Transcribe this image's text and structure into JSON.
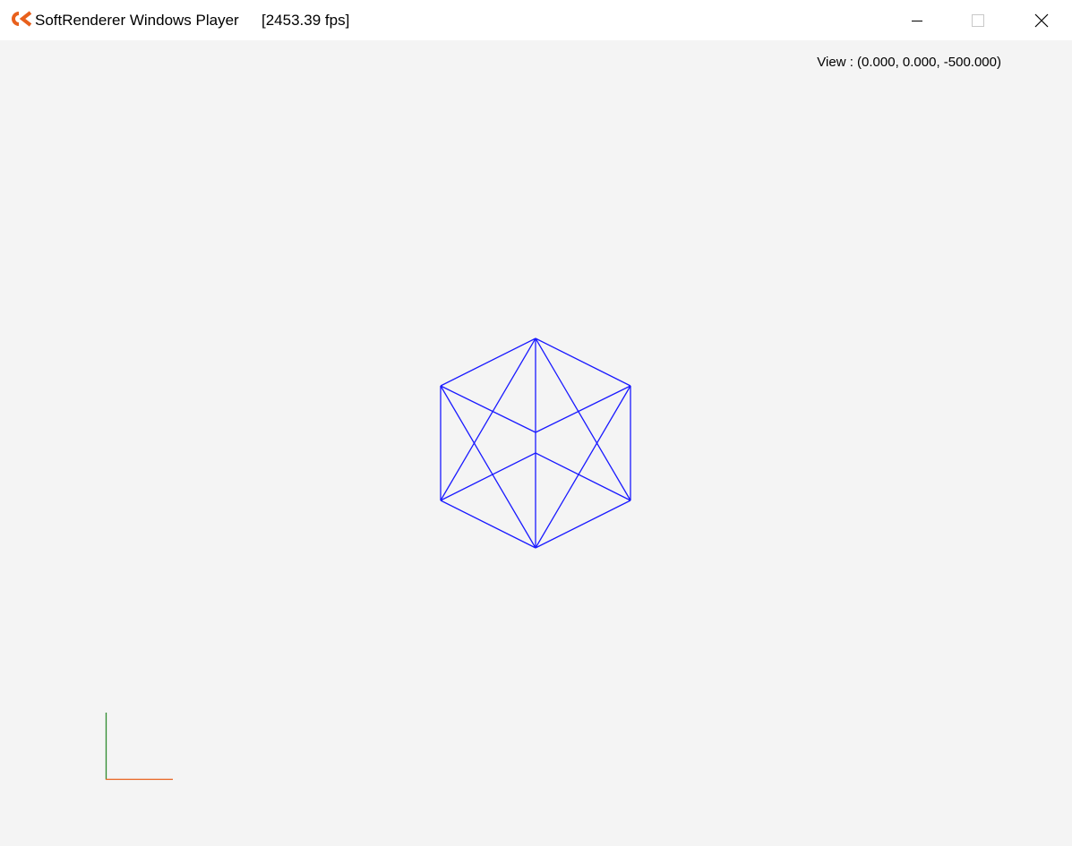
{
  "window": {
    "title": "SoftRenderer Windows Player",
    "fps": "[2453.39 fps]",
    "app_icon": "ck-logo-icon",
    "app_icon_color": "#e8601c",
    "controls": {
      "minimize_icon": "minimize-icon",
      "maximize_icon": "maximize-icon",
      "close_icon": "close-icon"
    }
  },
  "viewport": {
    "view_text": "View : (0.000, 0.000, -500.000)",
    "background_color": "#f4f4f4",
    "mesh": {
      "shape": "cube-wireframe",
      "color": "#1a1aff"
    },
    "axes_gizmo": {
      "x_axis_color": "#e8601c",
      "y_axis_color": "#2e8b2e"
    }
  }
}
